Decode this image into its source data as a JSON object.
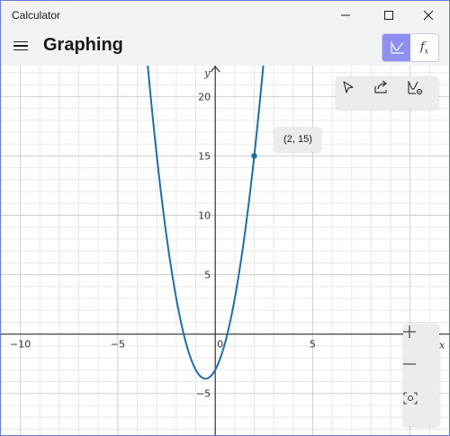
{
  "window": {
    "title": "Calculator",
    "controls": {
      "minimize": "—",
      "maximize": "☐",
      "close": "✕"
    }
  },
  "header": {
    "mode_title": "Graphing",
    "toggle": {
      "graph_icon": "graph-icon",
      "function_label": "f",
      "function_sub": "x"
    }
  },
  "graph_toolbar": {
    "icons": [
      "cursor-icon",
      "share-icon",
      "graph-settings-icon"
    ]
  },
  "zoom_controls": {
    "zoom_in": "+",
    "zoom_out": "−",
    "reset_icon": "recenter-icon"
  },
  "tooltip": {
    "text": "(2, 15)"
  },
  "colors": {
    "curve": "#1f6ea6",
    "accent": "#8f8ff0",
    "grid_minor": "#e8e8e8",
    "grid_major": "#cfcfcf",
    "axis": "#333333"
  },
  "chart_data": {
    "type": "line",
    "function": "y = 3x^2 + 3x - 3",
    "xlim": [
      -11,
      12
    ],
    "ylim": [
      -8.5,
      22.6
    ],
    "xlabel": "x",
    "ylabel": "y",
    "x_ticks": [
      -10,
      -5,
      0,
      5
    ],
    "y_ticks": [
      -5,
      5,
      10,
      15,
      20
    ],
    "x_tick_labels": [
      "−10",
      "−5",
      "0",
      "5"
    ],
    "y_tick_labels": [
      "−5",
      "5",
      "10",
      "15",
      "20"
    ],
    "grid": true,
    "highlighted_point": {
      "x": 2,
      "y": 15
    }
  }
}
